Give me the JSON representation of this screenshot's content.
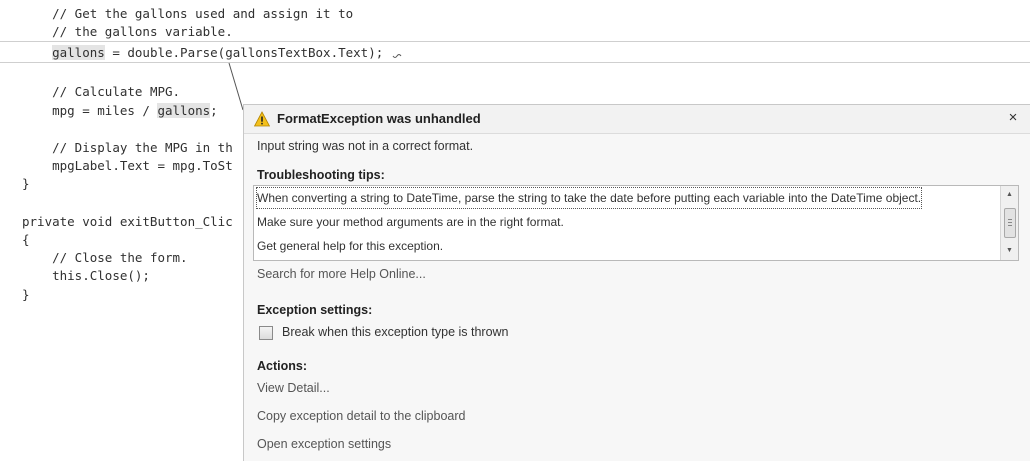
{
  "code": {
    "lines": [
      {
        "indent": "    ",
        "pre": "// Get the gallons used and assign it to",
        "hl": "",
        "post": ""
      },
      {
        "indent": "    ",
        "pre": "// the gallons variable.",
        "hl": "",
        "post": ""
      },
      {
        "indent": "    ",
        "pre": "",
        "hl": "gallons",
        "post": " = double.Parse(gallonsTextBox.Text);"
      },
      {
        "indent": "",
        "pre": "",
        "hl": "",
        "post": ""
      },
      {
        "indent": "    ",
        "pre": "// Calculate MPG.",
        "hl": "",
        "post": ""
      },
      {
        "indent": "    ",
        "pre": "mpg = miles / ",
        "hl": "gallons",
        "post": ";"
      },
      {
        "indent": "",
        "pre": "",
        "hl": "",
        "post": ""
      },
      {
        "indent": "    ",
        "pre": "// Display the MPG in th",
        "hl": "",
        "post": ""
      },
      {
        "indent": "    ",
        "pre": "mpgLabel.Text = mpg.ToSt",
        "hl": "",
        "post": ""
      },
      {
        "indent": "",
        "pre": "}",
        "hl": "",
        "post": ""
      },
      {
        "indent": "",
        "pre": "",
        "hl": "",
        "post": ""
      },
      {
        "indent": "",
        "pre": "private void exitButton_Clic",
        "hl": "",
        "post": ""
      },
      {
        "indent": "",
        "pre": "{",
        "hl": "",
        "post": ""
      },
      {
        "indent": "    ",
        "pre": "// Close the form.",
        "hl": "",
        "post": ""
      },
      {
        "indent": "    ",
        "pre": "this.Close();",
        "hl": "",
        "post": ""
      },
      {
        "indent": "",
        "pre": "}",
        "hl": "",
        "post": ""
      }
    ]
  },
  "exception": {
    "title": "FormatException was unhandled",
    "message": "Input string was not in a correct format.",
    "icon": "warning-icon",
    "close_glyph": "×",
    "accent_color": "#e8a900"
  },
  "troubleshooting": {
    "heading": "Troubleshooting tips:",
    "tips": [
      "When converting a string to DateTime, parse the string to take the date before putting each variable into the DateTime object.",
      "Make sure your method arguments are in the right format.",
      "Get general help for this exception."
    ],
    "selected_index": 0,
    "search_link": "Search for more Help Online..."
  },
  "settings": {
    "heading": "Exception settings:",
    "checkbox_label": "Break when this exception type is thrown",
    "checked": false
  },
  "actions": {
    "heading": "Actions:",
    "items": [
      "View Detail...",
      "Copy exception detail to the clipboard",
      "Open exception settings"
    ]
  }
}
